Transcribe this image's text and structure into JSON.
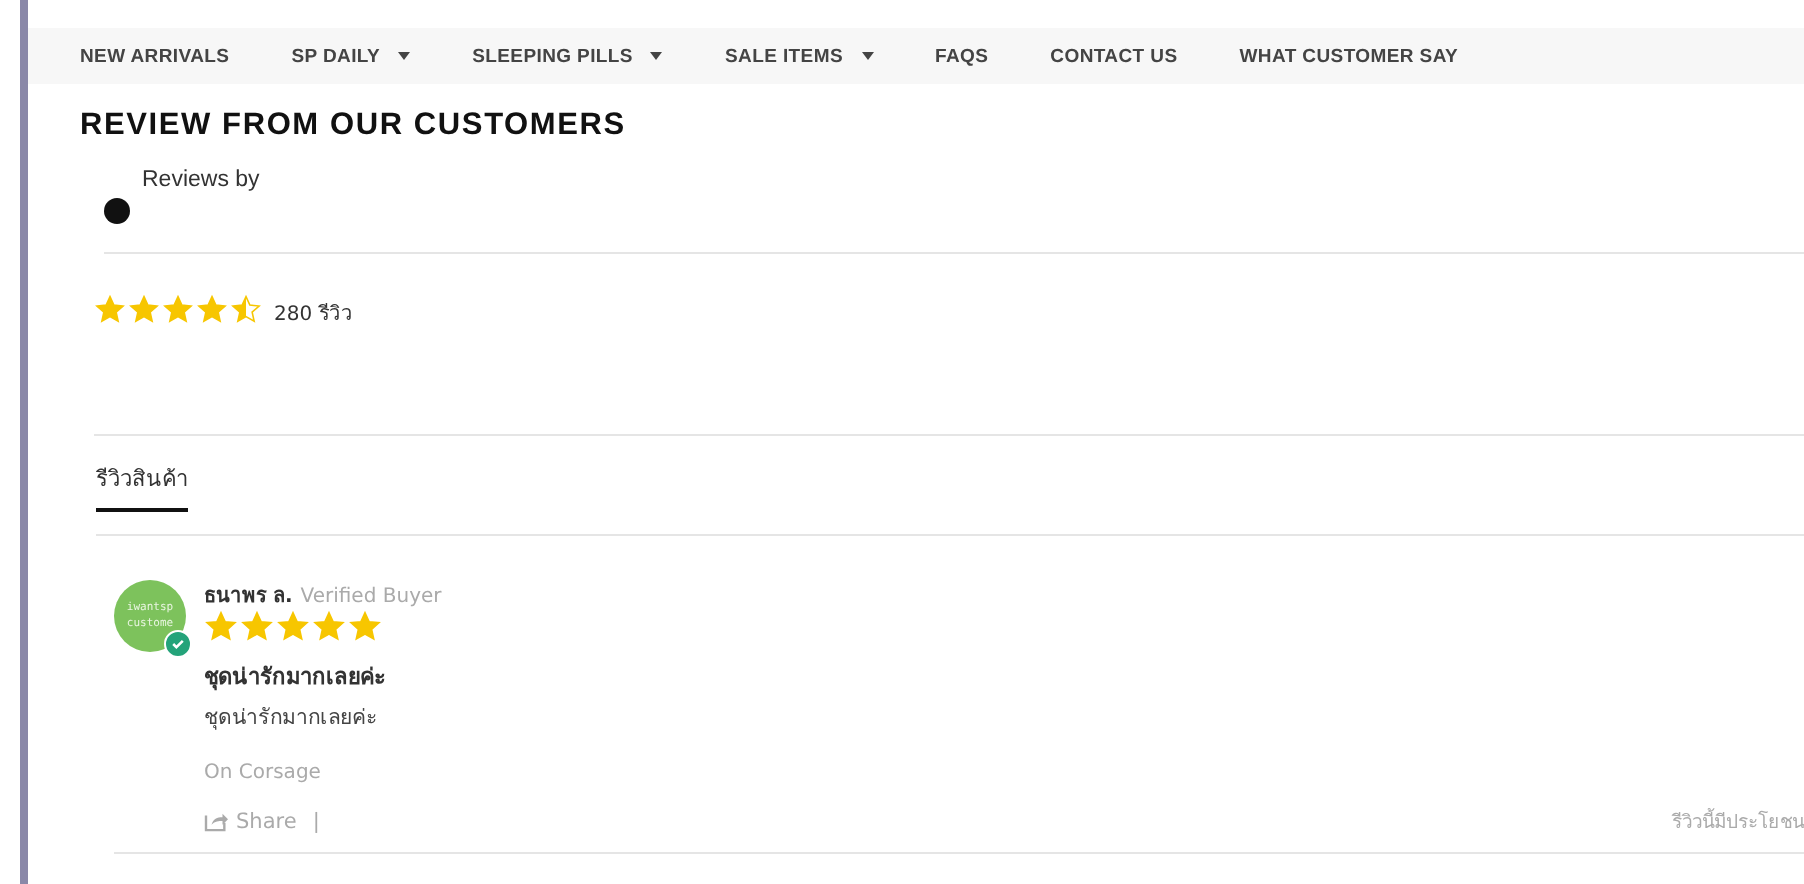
{
  "nav": [
    {
      "label": "NEW ARRIVALS",
      "dropdown": false
    },
    {
      "label": "SP DAILY",
      "dropdown": true
    },
    {
      "label": "SLEEPING PILLS",
      "dropdown": true
    },
    {
      "label": "SALE ITEMS",
      "dropdown": true
    },
    {
      "label": "FAQS",
      "dropdown": false
    },
    {
      "label": "CONTACT US",
      "dropdown": false
    },
    {
      "label": "WHAT CUSTOMER SAY",
      "dropdown": false
    }
  ],
  "heading": "REVIEW FROM OUR CUSTOMERS",
  "reviews_by": "Reviews by",
  "summary": {
    "stars": 4.5,
    "count": "280 รีวิว"
  },
  "tabs": [
    {
      "label": "รีวิวสินค้า",
      "selected": true
    }
  ],
  "reviews": [
    {
      "avatar_text": "iwantsp custome",
      "verified": true,
      "author": "ธนาพร ล.",
      "badge": "Verified Buyer",
      "stars": 5,
      "title": "ชุดน่ารักมากเลยค่ะ",
      "body": "ชุดน่ารักมากเลยค่ะ",
      "product": "On Corsage",
      "share": "Share",
      "separator": "|",
      "helpful": "รีวิวนี้มีประโยชน"
    }
  ]
}
